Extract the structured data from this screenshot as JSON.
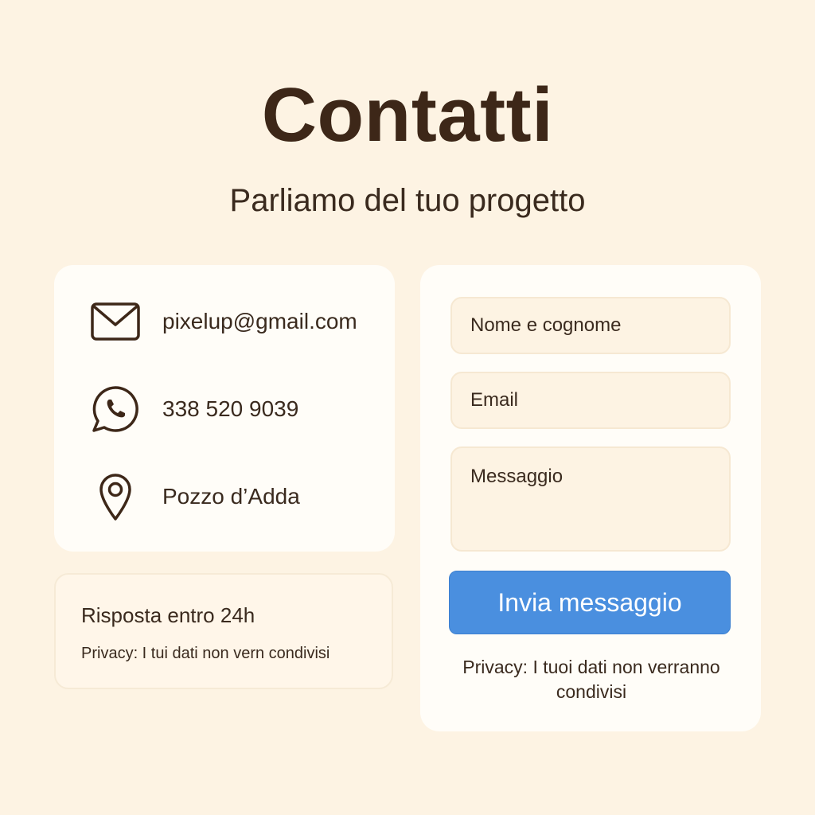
{
  "header": {
    "title": "Contatti",
    "subtitle": "Parliamo del tuo progetto"
  },
  "contacts": [
    {
      "icon": "mail-icon",
      "text": "pixelup@gmail.com"
    },
    {
      "icon": "whatsapp-icon",
      "text": "338 520 9039"
    },
    {
      "icon": "location-pin-icon",
      "text": "Pozzo d’Adda"
    }
  ],
  "info": {
    "response_time": "Risposta entro 24h",
    "privacy": "Privacy: I tui dati non vern condivisi"
  },
  "form": {
    "name_placeholder": "Nome e cognome",
    "email_placeholder": "Email",
    "message_placeholder": "Messaggio",
    "submit_label": "Invia messaggio",
    "privacy": "Privacy: I tuoi dati non verranno condivisi"
  },
  "colors": {
    "background": "#fdf3e3",
    "card": "#fffdf8",
    "text": "#3a2a1e",
    "accent": "#4a8fdf"
  }
}
